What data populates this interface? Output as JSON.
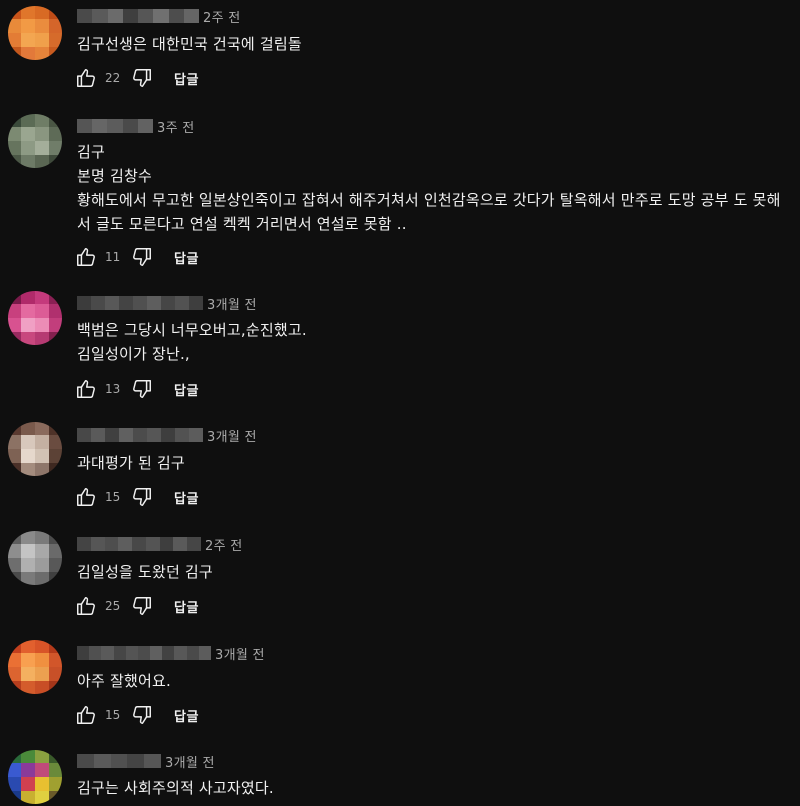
{
  "comments": [
    {
      "time": "2주 전",
      "text": "김구선생은 대한민국 건국에 걸림돌",
      "likes": "22",
      "reply": "답글",
      "avatar_colors": [
        "#c9541a",
        "#e0762b",
        "#d86a24",
        "#bf4c17",
        "#e88a3a",
        "#f29a45",
        "#ea8c3e",
        "#d4652a",
        "#e37c35",
        "#f3a651",
        "#f0a04b",
        "#d66b2b",
        "#c4581d",
        "#e2793a",
        "#e6843a",
        "#c85b1f"
      ],
      "name_colors": [
        "#4a4a4a",
        "#5a5a5a",
        "#6b6b6b",
        "#3f3f3f",
        "#565656",
        "#707070",
        "#4d4d4d",
        "#656565"
      ]
    },
    {
      "time": "3주 전",
      "text": "김구\n본명 김창수\n황해도에서 무고한 일본상인죽이고 잡혀서 해주거쳐서 인천감옥으로 갓다가 탈옥해서 만주로 도망 공부 도 못해서 글도 모른다고 연설 켁켁 거리면서 연설로 못함 ..",
      "likes": "11",
      "reply": "답글",
      "avatar_colors": [
        "#3a4a3a",
        "#5b6b55",
        "#6f7d66",
        "#4a5644",
        "#7c8a72",
        "#9aa690",
        "#8a9680",
        "#5e6b57",
        "#66745e",
        "#8d9a84",
        "#a4ae9a",
        "#707d69",
        "#4b5746",
        "#6d7a66",
        "#5a6653",
        "#3f4a3b"
      ],
      "name_colors": [
        "#555555",
        "#666666",
        "#5c5c5c",
        "#4a4a4a",
        "#626262"
      ]
    },
    {
      "time": "3개월 전",
      "text": "백범은 그당시 너무오버고,순진했고.\n김일성이가 장난.,",
      "likes": "13",
      "reply": "답글",
      "avatar_colors": [
        "#7a1a4a",
        "#b02a6a",
        "#c43a7c",
        "#8a2054",
        "#c8407e",
        "#e46aa0",
        "#dc5c96",
        "#b0306e",
        "#d85290",
        "#f0a0c4",
        "#ec8cb6",
        "#c23e7c",
        "#9a2a60",
        "#c8487e",
        "#b63a72",
        "#84204e"
      ],
      "name_colors": [
        "#3c3c3c",
        "#4a4a4a",
        "#585858",
        "#444444",
        "#505050",
        "#5e5e5e",
        "#464646",
        "#525252",
        "#3e3e3e"
      ]
    },
    {
      "time": "3개월 전",
      "text": "과대평가 된 김구",
      "likes": "15",
      "reply": "답글",
      "avatar_colors": [
        "#5a3a30",
        "#7a5a4c",
        "#8a6a5c",
        "#4e3228",
        "#8c7264",
        "#d8c8bc",
        "#c4b0a2",
        "#6a4c40",
        "#7e6254",
        "#e6d8cc",
        "#d2c2b4",
        "#5c4236",
        "#4a3028",
        "#a48c7e",
        "#8e766a",
        "#3e2820"
      ],
      "name_colors": [
        "#484848",
        "#5a5a5a",
        "#404040",
        "#606060",
        "#4c4c4c",
        "#565656",
        "#3e3e3e",
        "#525252",
        "#5c5c5c"
      ]
    },
    {
      "time": "2주 전",
      "text": "김일성을 도왔던 김구",
      "likes": "25",
      "reply": "답글",
      "avatar_colors": [
        "#5e5e5e",
        "#8a8a8a",
        "#7a7a7a",
        "#4c4c4c",
        "#8e8e8e",
        "#c4c4c4",
        "#a8a8a8",
        "#6a6a6a",
        "#6e6e6e",
        "#b0b0b0",
        "#9c9c9c",
        "#585858",
        "#4a4a4a",
        "#7a7a7a",
        "#6c6c6c",
        "#404040"
      ],
      "name_colors": [
        "#444444",
        "#565656",
        "#4e4e4e",
        "#5e5e5e",
        "#484848",
        "#545454",
        "#3e3e3e",
        "#5a5a5a",
        "#464646"
      ]
    },
    {
      "time": "3개월 전",
      "text": "아주 잘했어요.",
      "likes": "15",
      "reply": "답글",
      "avatar_colors": [
        "#c4401e",
        "#e2602e",
        "#d85428",
        "#b43a1a",
        "#ea7034",
        "#f8a050",
        "#f09040",
        "#d2562a",
        "#dc6430",
        "#f4b060",
        "#eca050",
        "#c85028",
        "#b63e1e",
        "#d45c2c",
        "#c84e26",
        "#a4361a"
      ],
      "name_colors": [
        "#3e3e3e",
        "#505050",
        "#5a5a5a",
        "#464646",
        "#545454",
        "#4c4c4c",
        "#606060",
        "#424242",
        "#585858",
        "#4a4a4a",
        "#5c5c5c"
      ]
    },
    {
      "time": "3개월 전",
      "text": "김구는 사회주의적 사고자였다.",
      "likes": "",
      "reply": "",
      "avatar_colors": [
        "#2a6a3a",
        "#4a8a3a",
        "#8aa040",
        "#3a5a2a",
        "#3a5ad0",
        "#8a3a9a",
        "#c04a7a",
        "#6a8a3a",
        "#2a4ab0",
        "#d04050",
        "#e8c030",
        "#a0a030",
        "#1a3a8a",
        "#c8b030",
        "#e0d040",
        "#6a5a2a"
      ],
      "name_colors": [
        "#4a4a4a",
        "#5a5a5a",
        "#505050",
        "#444444",
        "#565656"
      ]
    }
  ],
  "icons": {
    "like": "thumbs-up-icon",
    "dislike": "thumbs-down-icon"
  }
}
